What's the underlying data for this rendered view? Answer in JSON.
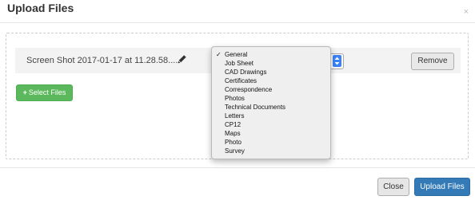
{
  "modal": {
    "title": "Upload Files",
    "close_glyph": "×"
  },
  "file": {
    "name": "Screen Shot 2017-01-17 at 11.28.58....",
    "edit_icon": "pencil-icon",
    "remove_label": "Remove"
  },
  "select_files": {
    "plus": "+",
    "label": "Select Files"
  },
  "category_select": {
    "selected": "General",
    "options": [
      "General",
      "Job Sheet",
      "CAD Drawings",
      "Certificates",
      "Correspondence",
      "Photos",
      "Technical Documents",
      "Letters",
      "CP12",
      "Maps",
      "Photo",
      "Survey"
    ],
    "check_glyph": "✓"
  },
  "footer": {
    "close_label": "Close",
    "upload_label": "Upload Files"
  },
  "colors": {
    "primary": "#337ab7",
    "success": "#5cb85c",
    "select_accent": "#3b82f6"
  }
}
